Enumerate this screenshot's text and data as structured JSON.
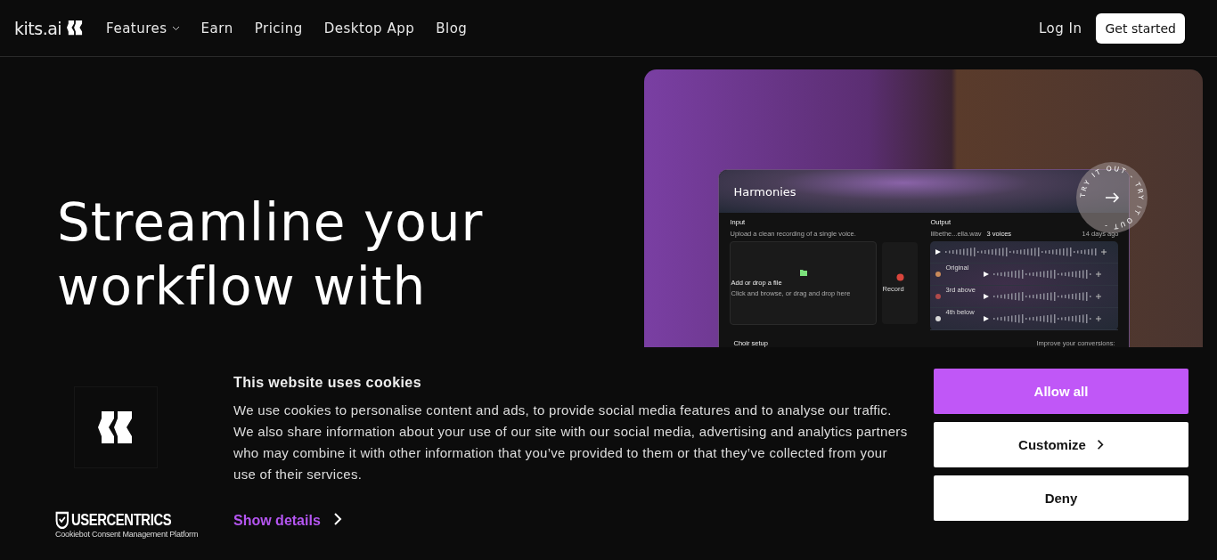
{
  "nav": {
    "logo": "kits.ai",
    "items": [
      {
        "label": "Features",
        "dropdown": true
      },
      {
        "label": "Earn",
        "dropdown": false
      },
      {
        "label": "Pricing",
        "dropdown": false
      },
      {
        "label": "Desktop App",
        "dropdown": false
      },
      {
        "label": "Blog",
        "dropdown": false
      }
    ],
    "login": "Log In",
    "cta": "Get started"
  },
  "hero": {
    "heading": [
      "Streamline your",
      "workflow with"
    ],
    "preview": {
      "title": "Harmonies",
      "try_badge": "TRY IT OUT - TRY IT OUT - ",
      "input": {
        "title": "Input",
        "hint": "Upload a clean recording of a single voice.",
        "drop_title": "Add or drop a file",
        "drop_hint": "Click and browse, or drag and drop here",
        "record": "Record"
      },
      "output": {
        "title": "Output",
        "file": "lilbethe...ella.wav",
        "voices": "3 voices",
        "time": "14 days ago",
        "tracks": [
          {
            "name": "Original",
            "color": "#c98a5a"
          },
          {
            "name": "3rd above",
            "color": "#b04a4a"
          },
          {
            "name": "4th below",
            "color": "#d9d9d9"
          }
        ]
      },
      "choir": "Choir setup",
      "feedback": "Improve your conversions:"
    }
  },
  "cookie": {
    "title": "This website uses cookies",
    "body": "We use cookies to personalise content and ads, to provide social media features and to analyse our traffic. We also share information about your use of our site with our social media, advertising and analytics partners who may combine it with other information that you’ve provided to them or that they’ve collected from your use of their services.",
    "details": "Show details",
    "brand": "USERCENTRICS",
    "brand_sub": "Cookiebot Consent Management Platform",
    "buttons": [
      {
        "label": "Allow all",
        "kind": "primary"
      },
      {
        "label": "Customize",
        "kind": "chevron"
      },
      {
        "label": "Deny",
        "kind": "plain"
      }
    ]
  }
}
